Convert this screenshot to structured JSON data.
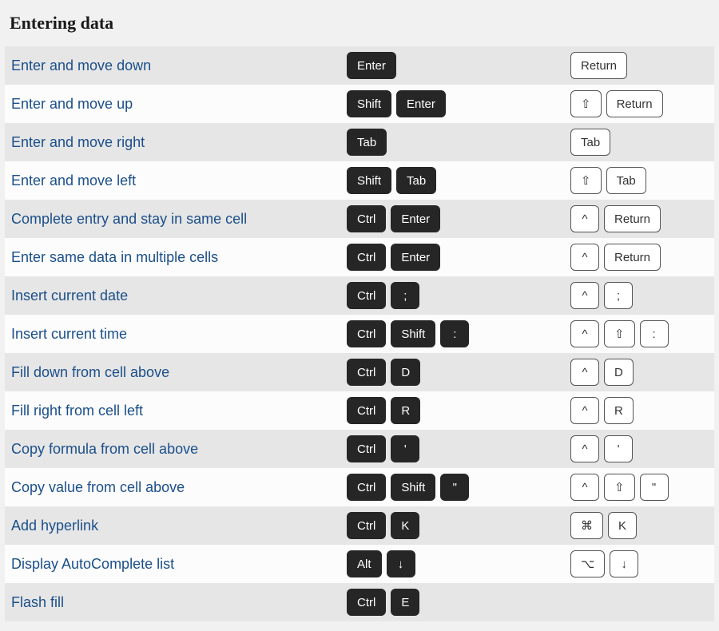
{
  "section_title": "Entering data",
  "rows": [
    {
      "desc": "Enter and move down",
      "win": [
        "Enter"
      ],
      "mac": [
        "Return"
      ]
    },
    {
      "desc": "Enter and move up",
      "win": [
        "Shift",
        "Enter"
      ],
      "mac": [
        "⇧",
        "Return"
      ]
    },
    {
      "desc": "Enter and move right",
      "win": [
        "Tab"
      ],
      "mac": [
        "Tab"
      ]
    },
    {
      "desc": "Enter and move left",
      "win": [
        "Shift",
        "Tab"
      ],
      "mac": [
        "⇧",
        "Tab"
      ]
    },
    {
      "desc": "Complete entry and stay in same cell",
      "win": [
        "Ctrl",
        "Enter"
      ],
      "mac": [
        "^",
        "Return"
      ]
    },
    {
      "desc": "Enter same data in multiple cells",
      "win": [
        "Ctrl",
        "Enter"
      ],
      "mac": [
        "^",
        "Return"
      ]
    },
    {
      "desc": "Insert current date",
      "win": [
        "Ctrl",
        ";"
      ],
      "mac": [
        "^",
        ";"
      ]
    },
    {
      "desc": "Insert current time",
      "win": [
        "Ctrl",
        "Shift",
        ":"
      ],
      "mac": [
        "^",
        "⇧",
        ":"
      ]
    },
    {
      "desc": "Fill down from cell above",
      "win": [
        "Ctrl",
        "D"
      ],
      "mac": [
        "^",
        "D"
      ]
    },
    {
      "desc": "Fill right from cell left",
      "win": [
        "Ctrl",
        "R"
      ],
      "mac": [
        "^",
        "R"
      ]
    },
    {
      "desc": "Copy formula from cell above",
      "win": [
        "Ctrl",
        "'"
      ],
      "mac": [
        "^",
        "'"
      ]
    },
    {
      "desc": "Copy value from cell above",
      "win": [
        "Ctrl",
        "Shift",
        "\""
      ],
      "mac": [
        "^",
        "⇧",
        "\""
      ]
    },
    {
      "desc": "Add hyperlink",
      "win": [
        "Ctrl",
        "K"
      ],
      "mac": [
        "⌘",
        "K"
      ]
    },
    {
      "desc": "Display AutoComplete list",
      "win": [
        "Alt",
        "↓"
      ],
      "mac": [
        "⌥",
        "↓"
      ]
    },
    {
      "desc": "Flash fill",
      "win": [
        "Ctrl",
        "E"
      ],
      "mac": []
    }
  ]
}
